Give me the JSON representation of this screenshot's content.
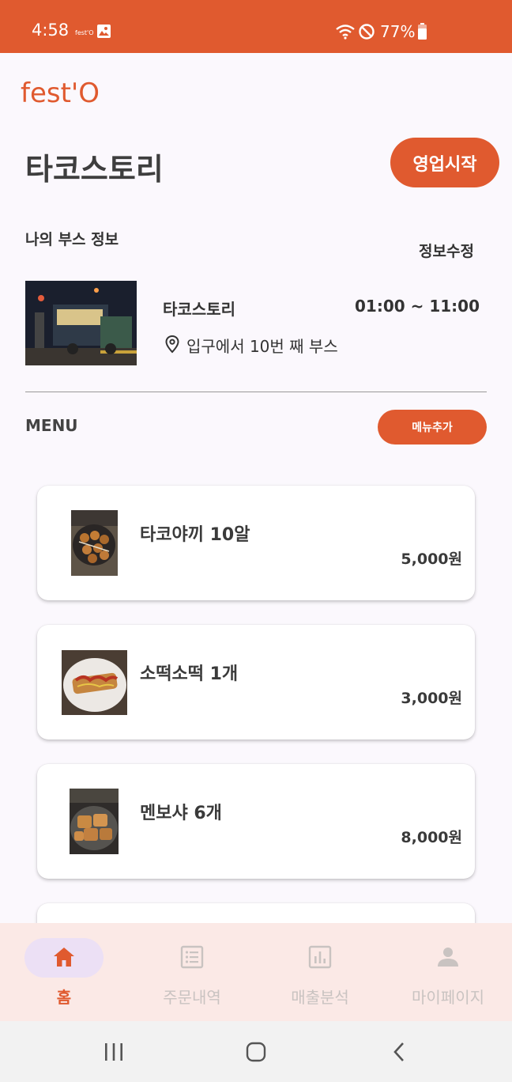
{
  "status_bar": {
    "time": "4:58",
    "mini_text": "fest'O",
    "battery": "77%",
    "icons": [
      "image-icon",
      "wifi-icon",
      "do-not-disturb-icon",
      "battery-icon"
    ]
  },
  "app": {
    "logo": "fest'O",
    "accent_color": "#e05a2f"
  },
  "booth": {
    "title": "타코스토리",
    "open_button": "영업시작",
    "section_label": "나의 부스 정보",
    "edit_label": "정보수정",
    "name": "타코스토리",
    "hours": "01:00 ~ 11:00",
    "location": "입구에서 10번 째 부스"
  },
  "menu": {
    "heading": "MENU",
    "add_button": "메뉴추가",
    "items": [
      {
        "name": "타코야끼 10알",
        "price": "5,000원"
      },
      {
        "name": "소떡소떡 1개",
        "price": "3,000원"
      },
      {
        "name": "멘보샤 6개",
        "price": "8,000원"
      }
    ]
  },
  "bottom_nav": {
    "items": [
      {
        "label": "홈",
        "icon": "home-icon",
        "active": true
      },
      {
        "label": "주문내역",
        "icon": "list-icon",
        "active": false
      },
      {
        "label": "매출분석",
        "icon": "chart-icon",
        "active": false
      },
      {
        "label": "마이페이지",
        "icon": "person-icon",
        "active": false
      }
    ]
  },
  "system_nav": {
    "icons": [
      "recent-apps-icon",
      "home-circle-icon",
      "back-icon"
    ]
  }
}
